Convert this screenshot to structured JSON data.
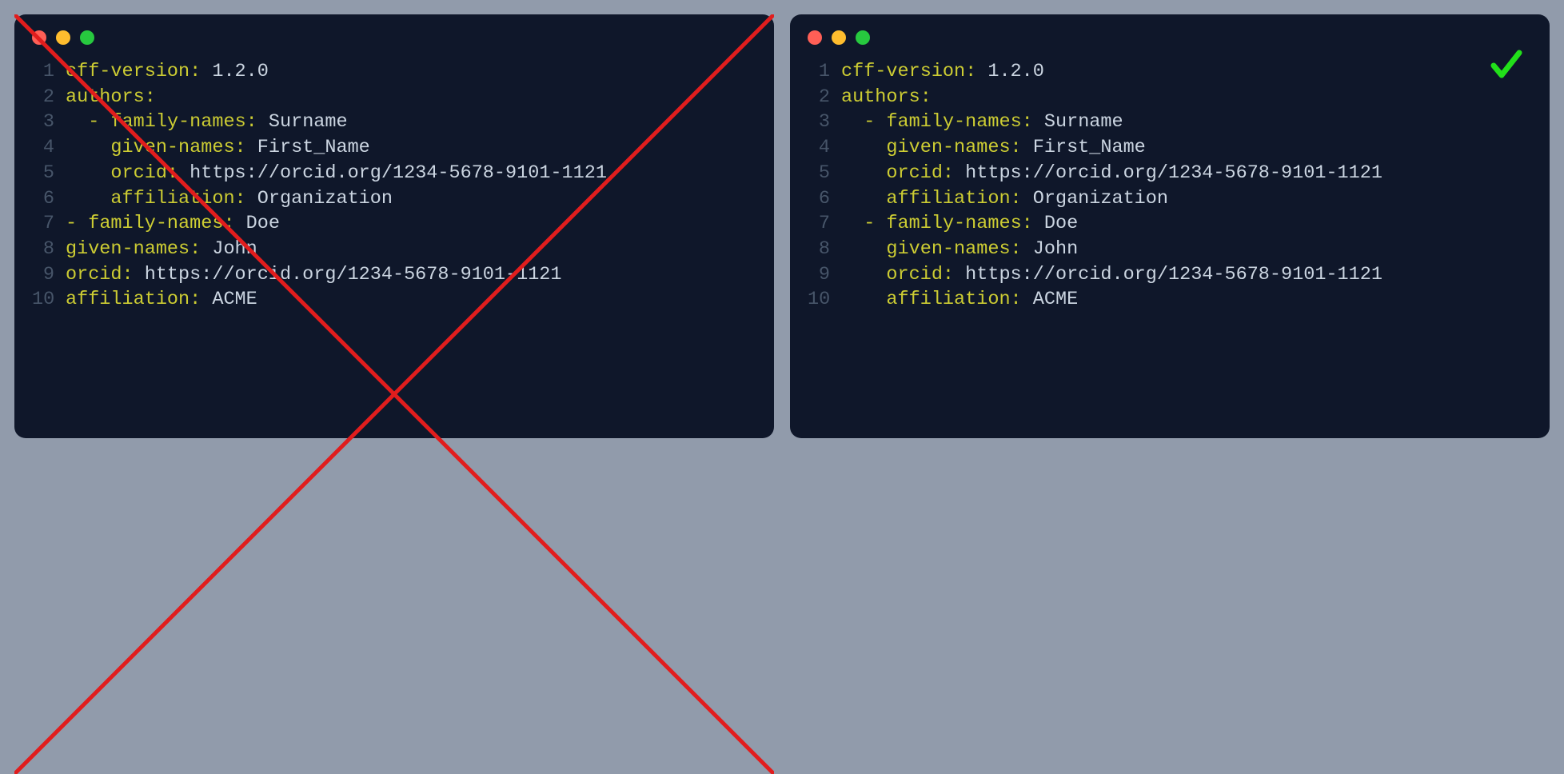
{
  "left": {
    "status": "incorrect",
    "lines": [
      {
        "num": 1,
        "indent": "",
        "dash": "",
        "key": "cff-version:",
        "val": " 1.2.0"
      },
      {
        "num": 2,
        "indent": "",
        "dash": "",
        "key": "authors:",
        "val": ""
      },
      {
        "num": 3,
        "indent": "  ",
        "dash": "- ",
        "key": "family-names:",
        "val": " Surname"
      },
      {
        "num": 4,
        "indent": "    ",
        "dash": "",
        "key": "given-names:",
        "val": " First_Name"
      },
      {
        "num": 5,
        "indent": "    ",
        "dash": "",
        "key": "orcid:",
        "val": " https://orcid.org/1234-5678-9101-1121"
      },
      {
        "num": 6,
        "indent": "    ",
        "dash": "",
        "key": "affiliation:",
        "val": " Organization"
      },
      {
        "num": 7,
        "indent": "",
        "dash": "- ",
        "key": "family-names:",
        "val": " Doe"
      },
      {
        "num": 8,
        "indent": "",
        "dash": "",
        "key": "given-names:",
        "val": " John"
      },
      {
        "num": 9,
        "indent": "",
        "dash": "",
        "key": "orcid:",
        "val": " https://orcid.org/1234-5678-9101-1121"
      },
      {
        "num": 10,
        "indent": "",
        "dash": "",
        "key": "affiliation:",
        "val": " ACME"
      }
    ]
  },
  "right": {
    "status": "correct",
    "lines": [
      {
        "num": 1,
        "indent": "",
        "dash": "",
        "key": "cff-version:",
        "val": " 1.2.0"
      },
      {
        "num": 2,
        "indent": "",
        "dash": "",
        "key": "authors:",
        "val": ""
      },
      {
        "num": 3,
        "indent": "  ",
        "dash": "- ",
        "key": "family-names:",
        "val": " Surname"
      },
      {
        "num": 4,
        "indent": "    ",
        "dash": "",
        "key": "given-names:",
        "val": " First_Name"
      },
      {
        "num": 5,
        "indent": "    ",
        "dash": "",
        "key": "orcid:",
        "val": " https://orcid.org/1234-5678-9101-1121"
      },
      {
        "num": 6,
        "indent": "    ",
        "dash": "",
        "key": "affiliation:",
        "val": " Organization"
      },
      {
        "num": 7,
        "indent": "  ",
        "dash": "- ",
        "key": "family-names:",
        "val": " Doe"
      },
      {
        "num": 8,
        "indent": "    ",
        "dash": "",
        "key": "given-names:",
        "val": " John"
      },
      {
        "num": 9,
        "indent": "    ",
        "dash": "",
        "key": "orcid:",
        "val": " https://orcid.org/1234-5678-9101-1121"
      },
      {
        "num": 10,
        "indent": "    ",
        "dash": "",
        "key": "affiliation:",
        "val": " ACME"
      }
    ]
  },
  "icons": {
    "cross": "✕",
    "check": "✓"
  }
}
